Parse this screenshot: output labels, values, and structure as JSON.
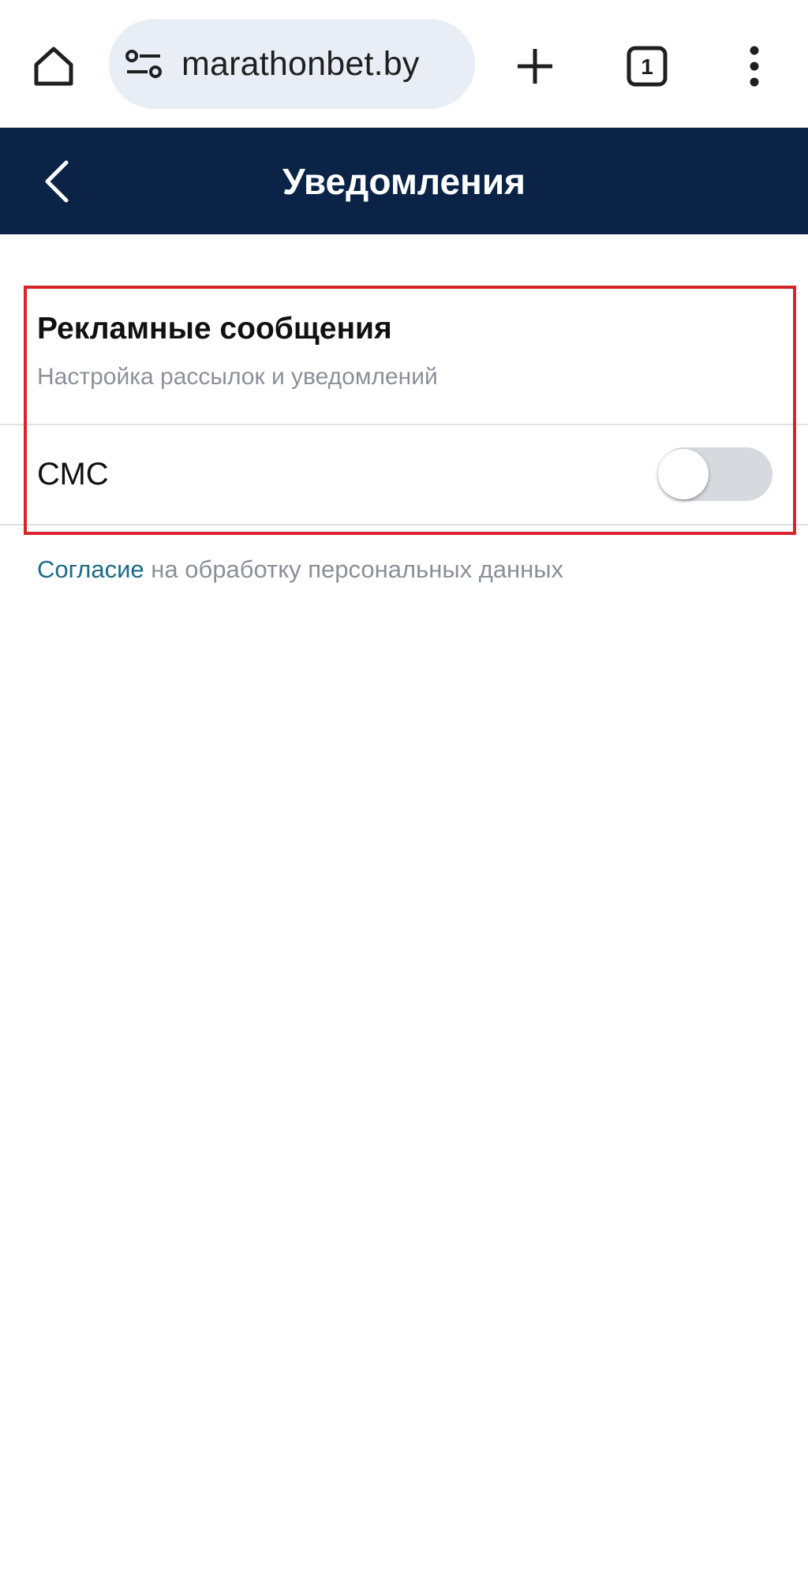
{
  "browser": {
    "url": "marathonbet.by",
    "tab_count": "1",
    "icons": {
      "home": "home-icon",
      "site_settings": "tune-icon",
      "new_tab": "plus-icon",
      "tabs": "tab-count-icon",
      "menu": "more-vert-icon"
    }
  },
  "header": {
    "title": "Уведомления",
    "back_icon": "chevron-left-icon",
    "background_color": "#0a2347"
  },
  "section": {
    "title": "Рекламные сообщения",
    "subtitle": "Настройка рассылок и уведомлений"
  },
  "sms": {
    "label": "СМС",
    "enabled": false
  },
  "consent": {
    "link_text": "Согласие",
    "rest_text": " на обработку персональных данных",
    "link_color": "#1d6a86"
  },
  "colors": {
    "highlight_frame": "#d8232a",
    "toggle_off": "#d6d9de"
  }
}
